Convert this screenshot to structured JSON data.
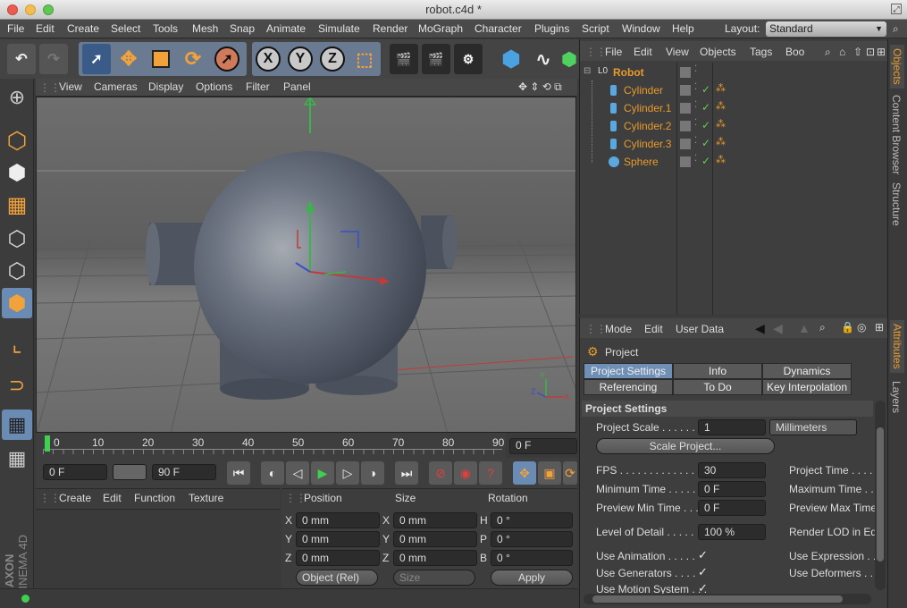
{
  "window": {
    "title": "robot.c4d *"
  },
  "menubar": {
    "items": [
      "File",
      "Edit",
      "Create",
      "Select",
      "Tools",
      "Mesh",
      "Snap",
      "Animate",
      "Simulate",
      "Render",
      "MoGraph",
      "Character",
      "Plugins",
      "Script",
      "Window",
      "Help"
    ],
    "layout_label": "Layout:",
    "layout_value": "Standard"
  },
  "toolbar": {
    "axes": [
      "X",
      "Y",
      "Z"
    ]
  },
  "viewport": {
    "menu": [
      "View",
      "Cameras",
      "Display",
      "Options",
      "Filter",
      "Panel"
    ],
    "axis_labels": {
      "x": "X",
      "y": "Y",
      "z": "Z"
    }
  },
  "timeline": {
    "ticks": [
      "0",
      "10",
      "20",
      "30",
      "40",
      "50",
      "60",
      "70",
      "80",
      "90"
    ],
    "current_frame": "0 F"
  },
  "transport": {
    "start_frame": "0 F",
    "end_frame": "90 F"
  },
  "material_manager": {
    "menu": [
      "Create",
      "Edit",
      "Function",
      "Texture"
    ]
  },
  "coordinates": {
    "headers": {
      "position": "Position",
      "size": "Size",
      "rotation": "Rotation"
    },
    "rows": [
      {
        "axis_pos": "X",
        "pos": "0 mm",
        "axis_size": "X",
        "size": "0 mm",
        "axis_rot": "H",
        "rot": "0 °"
      },
      {
        "axis_pos": "Y",
        "pos": "0 mm",
        "axis_size": "Y",
        "size": "0 mm",
        "axis_rot": "P",
        "rot": "0 °"
      },
      {
        "axis_pos": "Z",
        "pos": "0 mm",
        "axis_size": "Z",
        "size": "0 mm",
        "axis_rot": "B",
        "rot": "0 °"
      }
    ],
    "mode_select": "Object (Rel)",
    "size_select": "Size",
    "apply_label": "Apply"
  },
  "object_manager": {
    "menu": [
      "File",
      "Edit",
      "View",
      "Objects",
      "Tags",
      "Boo"
    ],
    "objects": [
      {
        "name": "Robot",
        "type": "null",
        "level": 0
      },
      {
        "name": "Cylinder",
        "type": "cylinder",
        "level": 1
      },
      {
        "name": "Cylinder.1",
        "type": "cylinder",
        "level": 1
      },
      {
        "name": "Cylinder.2",
        "type": "cylinder",
        "level": 1
      },
      {
        "name": "Cylinder.3",
        "type": "cylinder",
        "level": 1
      },
      {
        "name": "Sphere",
        "type": "sphere",
        "level": 1
      }
    ]
  },
  "attribute_manager": {
    "menu": [
      "Mode",
      "Edit",
      "User Data"
    ],
    "title": "Project",
    "tabs": [
      {
        "label": "Project Settings",
        "active": true
      },
      {
        "label": "Info",
        "active": false
      },
      {
        "label": "Dynamics",
        "active": false
      },
      {
        "label": "Referencing",
        "active": false
      },
      {
        "label": "To Do",
        "active": false
      },
      {
        "label": "Key Interpolation",
        "active": false
      }
    ],
    "section_title": "Project Settings",
    "project_scale_label": "Project Scale . . . . . . .",
    "project_scale_value": "1",
    "project_scale_unit": "Millimeters",
    "scale_project_button": "Scale Project...",
    "fps_label": "FPS . . . . . . . . . . . . . .",
    "fps_value": "30",
    "min_time_label": "Minimum Time . . . . .",
    "min_time_value": "0 F",
    "preview_min_label": "Preview Min Time . . .",
    "preview_min_value": "0 F",
    "lod_label": "Level of Detail . . . . .",
    "lod_value": "100 %",
    "use_animation_label": "Use Animation . . . . .",
    "use_generators_label": "Use Generators . . . .",
    "use_motion_label": "Use Motion System . . .",
    "project_time_label": "Project Time . . . . .",
    "max_time_label": "Maximum Time . . .",
    "preview_max_label": "Preview Max Time",
    "render_lod_label": "Render LOD in Ed",
    "use_expression_label": "Use Expression . . .",
    "use_deformers_label": "Use Deformers . . . ."
  },
  "side_tabs": [
    "Objects",
    "Content Browser",
    "Structure",
    "Attributes",
    "Layers"
  ],
  "branding": {
    "brand": "MAXON",
    "product": "CINEMA 4D"
  }
}
